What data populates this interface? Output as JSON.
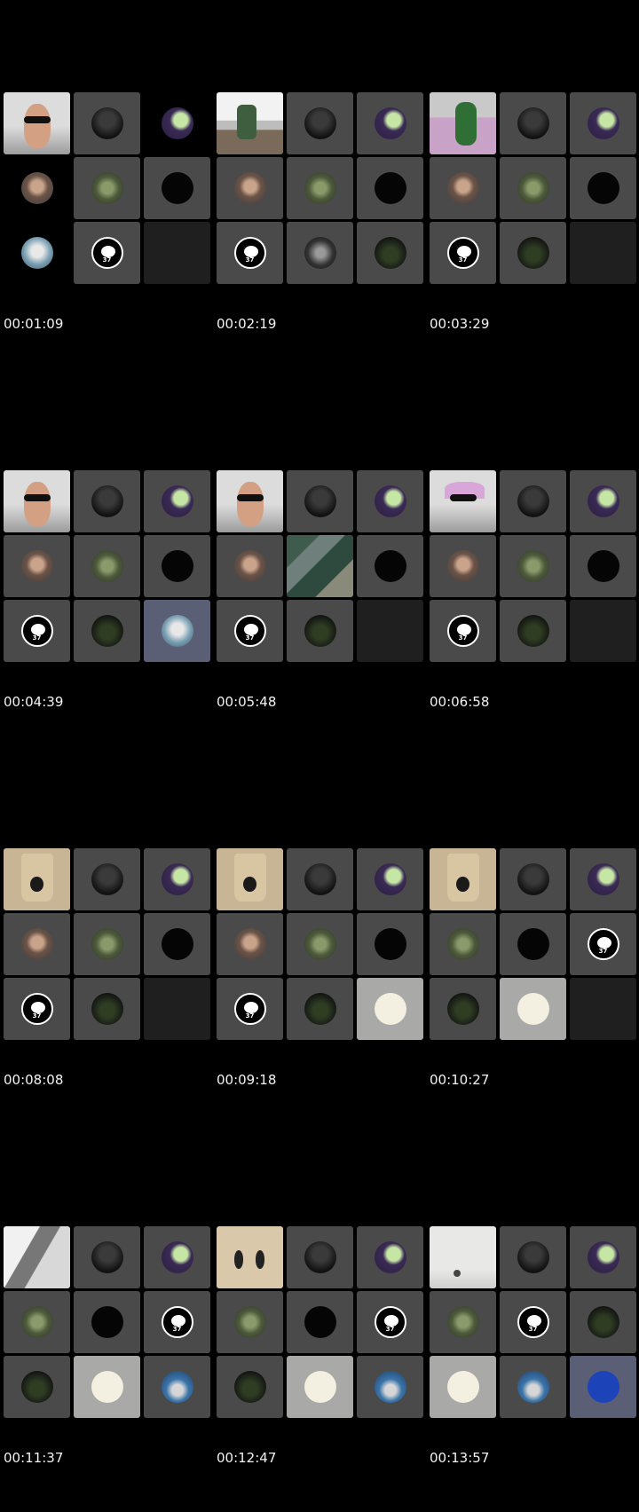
{
  "frames": [
    {
      "timestamp": "00:01:09",
      "tiles": [
        {
          "kind": "video",
          "feed": "glasses",
          "name": "participant-video"
        },
        {
          "kind": "avatar",
          "avatar": "dark",
          "name": "participant-avatar"
        },
        {
          "kind": "avatar",
          "avatar": "purple",
          "bg": "blank",
          "name": "participant-avatar"
        },
        {
          "kind": "avatar",
          "avatar": "selfie",
          "bg": "blank",
          "name": "participant-avatar"
        },
        {
          "kind": "avatar",
          "avatar": "street",
          "name": "participant-avatar"
        },
        {
          "kind": "avatar",
          "avatar": "black",
          "name": "participant-avatar"
        },
        {
          "kind": "avatar",
          "avatar": "light",
          "bg": "blank",
          "name": "participant-avatar"
        },
        {
          "kind": "logo",
          "logo_text": "37",
          "name": "participant-logo"
        },
        {
          "kind": "empty",
          "name": "empty-tile"
        }
      ]
    },
    {
      "timestamp": "00:02:19",
      "tiles": [
        {
          "kind": "video",
          "feed": "kitchen",
          "name": "participant-video"
        },
        {
          "kind": "avatar",
          "avatar": "dark",
          "name": "participant-avatar"
        },
        {
          "kind": "avatar",
          "avatar": "purple",
          "name": "participant-avatar"
        },
        {
          "kind": "avatar",
          "avatar": "selfie",
          "name": "participant-avatar"
        },
        {
          "kind": "avatar",
          "avatar": "street",
          "name": "participant-avatar"
        },
        {
          "kind": "avatar",
          "avatar": "black",
          "name": "participant-avatar"
        },
        {
          "kind": "logo",
          "logo_text": "37",
          "name": "participant-logo"
        },
        {
          "kind": "avatar",
          "avatar": "mono",
          "name": "participant-avatar"
        },
        {
          "kind": "avatar",
          "avatar": "night",
          "name": "participant-avatar"
        }
      ]
    },
    {
      "timestamp": "00:03:29",
      "tiles": [
        {
          "kind": "video",
          "feed": "green",
          "name": "participant-video"
        },
        {
          "kind": "avatar",
          "avatar": "dark",
          "name": "participant-avatar"
        },
        {
          "kind": "avatar",
          "avatar": "purple",
          "name": "participant-avatar"
        },
        {
          "kind": "avatar",
          "avatar": "selfie",
          "name": "participant-avatar"
        },
        {
          "kind": "avatar",
          "avatar": "street",
          "name": "participant-avatar"
        },
        {
          "kind": "avatar",
          "avatar": "black",
          "name": "participant-avatar"
        },
        {
          "kind": "logo",
          "logo_text": "37",
          "name": "participant-logo"
        },
        {
          "kind": "avatar",
          "avatar": "night",
          "name": "participant-avatar"
        },
        {
          "kind": "empty",
          "name": "empty-tile"
        }
      ]
    },
    {
      "timestamp": "00:04:39",
      "tiles": [
        {
          "kind": "video",
          "feed": "glasses",
          "name": "participant-video"
        },
        {
          "kind": "avatar",
          "avatar": "dark",
          "name": "participant-avatar"
        },
        {
          "kind": "avatar",
          "avatar": "purple",
          "name": "participant-avatar"
        },
        {
          "kind": "avatar",
          "avatar": "selfie",
          "name": "participant-avatar"
        },
        {
          "kind": "avatar",
          "avatar": "street",
          "name": "participant-avatar"
        },
        {
          "kind": "avatar",
          "avatar": "black",
          "name": "participant-avatar"
        },
        {
          "kind": "logo",
          "logo_text": "37",
          "name": "participant-logo"
        },
        {
          "kind": "avatar",
          "avatar": "night",
          "name": "participant-avatar"
        },
        {
          "kind": "avatar",
          "avatar": "light",
          "bg": "blue",
          "name": "participant-avatar"
        }
      ]
    },
    {
      "timestamp": "00:05:48",
      "tiles": [
        {
          "kind": "video",
          "feed": "glasses",
          "name": "participant-video"
        },
        {
          "kind": "avatar",
          "avatar": "dark",
          "name": "participant-avatar"
        },
        {
          "kind": "avatar",
          "avatar": "purple",
          "name": "participant-avatar"
        },
        {
          "kind": "avatar",
          "avatar": "selfie",
          "name": "participant-avatar"
        },
        {
          "kind": "video",
          "feed": "map",
          "name": "screen-share-video"
        },
        {
          "kind": "avatar",
          "avatar": "black",
          "name": "participant-avatar"
        },
        {
          "kind": "logo",
          "logo_text": "37",
          "name": "participant-logo"
        },
        {
          "kind": "avatar",
          "avatar": "night",
          "name": "participant-avatar"
        },
        {
          "kind": "empty",
          "name": "empty-tile"
        }
      ]
    },
    {
      "timestamp": "00:06:58",
      "tiles": [
        {
          "kind": "video",
          "feed": "glasses-pink",
          "name": "participant-video"
        },
        {
          "kind": "avatar",
          "avatar": "dark",
          "name": "participant-avatar"
        },
        {
          "kind": "avatar",
          "avatar": "purple",
          "name": "participant-avatar"
        },
        {
          "kind": "avatar",
          "avatar": "selfie",
          "name": "participant-avatar"
        },
        {
          "kind": "avatar",
          "avatar": "street",
          "name": "participant-avatar"
        },
        {
          "kind": "avatar",
          "avatar": "black",
          "name": "participant-avatar"
        },
        {
          "kind": "logo",
          "logo_text": "37",
          "name": "participant-logo"
        },
        {
          "kind": "avatar",
          "avatar": "night",
          "name": "participant-avatar"
        },
        {
          "kind": "empty",
          "name": "empty-tile"
        }
      ]
    },
    {
      "timestamp": "00:08:08",
      "tiles": [
        {
          "kind": "video",
          "feed": "bag",
          "name": "participant-video"
        },
        {
          "kind": "avatar",
          "avatar": "dark",
          "name": "participant-avatar"
        },
        {
          "kind": "avatar",
          "avatar": "purple",
          "name": "participant-avatar"
        },
        {
          "kind": "avatar",
          "avatar": "selfie",
          "name": "participant-avatar"
        },
        {
          "kind": "avatar",
          "avatar": "street",
          "name": "participant-avatar"
        },
        {
          "kind": "avatar",
          "avatar": "black",
          "name": "participant-avatar"
        },
        {
          "kind": "logo",
          "logo_text": "37",
          "name": "participant-logo"
        },
        {
          "kind": "avatar",
          "avatar": "night",
          "name": "participant-avatar"
        },
        {
          "kind": "empty",
          "name": "empty-tile"
        }
      ]
    },
    {
      "timestamp": "00:09:18",
      "tiles": [
        {
          "kind": "video",
          "feed": "bag",
          "name": "participant-video"
        },
        {
          "kind": "avatar",
          "avatar": "dark",
          "name": "participant-avatar"
        },
        {
          "kind": "avatar",
          "avatar": "purple",
          "name": "participant-avatar"
        },
        {
          "kind": "avatar",
          "avatar": "selfie",
          "name": "participant-avatar"
        },
        {
          "kind": "avatar",
          "avatar": "street",
          "name": "participant-avatar"
        },
        {
          "kind": "avatar",
          "avatar": "black",
          "name": "participant-avatar"
        },
        {
          "kind": "logo",
          "logo_text": "37",
          "name": "participant-logo"
        },
        {
          "kind": "avatar",
          "avatar": "night",
          "name": "participant-avatar"
        },
        {
          "kind": "avatar",
          "avatar": "cream",
          "bg": "light",
          "name": "participant-avatar"
        }
      ]
    },
    {
      "timestamp": "00:10:27",
      "tiles": [
        {
          "kind": "video",
          "feed": "bag",
          "name": "participant-video"
        },
        {
          "kind": "avatar",
          "avatar": "dark",
          "name": "participant-avatar"
        },
        {
          "kind": "avatar",
          "avatar": "purple",
          "name": "participant-avatar"
        },
        {
          "kind": "avatar",
          "avatar": "street",
          "name": "participant-avatar"
        },
        {
          "kind": "avatar",
          "avatar": "black",
          "name": "participant-avatar"
        },
        {
          "kind": "logo",
          "logo_text": "37",
          "name": "participant-logo"
        },
        {
          "kind": "avatar",
          "avatar": "night",
          "name": "participant-avatar"
        },
        {
          "kind": "avatar",
          "avatar": "cream",
          "bg": "light",
          "name": "participant-avatar"
        },
        {
          "kind": "empty",
          "name": "empty-tile"
        }
      ]
    },
    {
      "timestamp": "00:11:37",
      "tiles": [
        {
          "kind": "video",
          "feed": "blur",
          "name": "participant-video"
        },
        {
          "kind": "avatar",
          "avatar": "dark",
          "name": "participant-avatar"
        },
        {
          "kind": "avatar",
          "avatar": "purple",
          "name": "participant-avatar"
        },
        {
          "kind": "avatar",
          "avatar": "street",
          "name": "participant-avatar"
        },
        {
          "kind": "avatar",
          "avatar": "black",
          "name": "participant-avatar"
        },
        {
          "kind": "logo",
          "logo_text": "37",
          "name": "participant-logo"
        },
        {
          "kind": "avatar",
          "avatar": "night",
          "name": "participant-avatar"
        },
        {
          "kind": "avatar",
          "avatar": "cream",
          "bg": "light",
          "name": "participant-avatar"
        },
        {
          "kind": "avatar",
          "avatar": "sky",
          "name": "participant-avatar"
        }
      ]
    },
    {
      "timestamp": "00:12:47",
      "tiles": [
        {
          "kind": "video",
          "feed": "bag2",
          "name": "participant-video"
        },
        {
          "kind": "avatar",
          "avatar": "dark",
          "name": "participant-avatar"
        },
        {
          "kind": "avatar",
          "avatar": "purple",
          "name": "participant-avatar"
        },
        {
          "kind": "avatar",
          "avatar": "street",
          "name": "participant-avatar"
        },
        {
          "kind": "avatar",
          "avatar": "black",
          "name": "participant-avatar"
        },
        {
          "kind": "logo",
          "logo_text": "37",
          "name": "participant-logo"
        },
        {
          "kind": "avatar",
          "avatar": "night",
          "name": "participant-avatar"
        },
        {
          "kind": "avatar",
          "avatar": "cream",
          "bg": "light",
          "name": "participant-avatar"
        },
        {
          "kind": "avatar",
          "avatar": "sky",
          "name": "participant-avatar"
        }
      ]
    },
    {
      "timestamp": "00:13:57",
      "tiles": [
        {
          "kind": "video",
          "feed": "white",
          "name": "participant-video"
        },
        {
          "kind": "avatar",
          "avatar": "dark",
          "name": "participant-avatar"
        },
        {
          "kind": "avatar",
          "avatar": "purple",
          "name": "participant-avatar"
        },
        {
          "kind": "avatar",
          "avatar": "street",
          "name": "participant-avatar"
        },
        {
          "kind": "logo",
          "logo_text": "37",
          "name": "participant-logo"
        },
        {
          "kind": "avatar",
          "avatar": "night",
          "name": "participant-avatar"
        },
        {
          "kind": "avatar",
          "avatar": "cream",
          "bg": "light",
          "name": "participant-avatar"
        },
        {
          "kind": "avatar",
          "avatar": "sky",
          "name": "participant-avatar"
        },
        {
          "kind": "avatar",
          "avatar": "royal",
          "bg": "blue",
          "name": "participant-avatar"
        }
      ]
    }
  ]
}
